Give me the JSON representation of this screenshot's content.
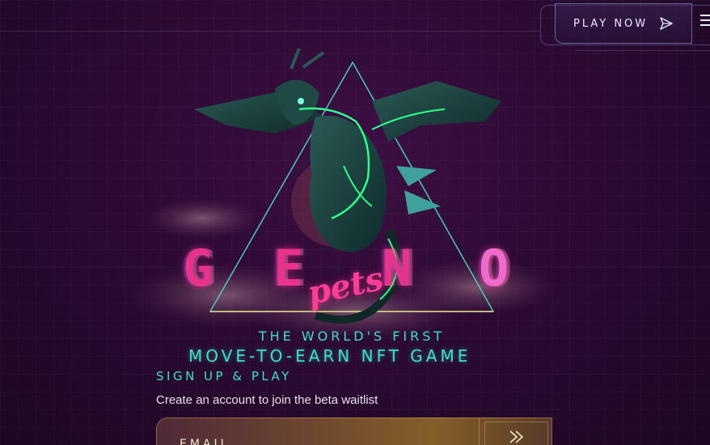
{
  "header": {
    "play_label": "PLAY NOW",
    "play_icon": "paper-plane-icon",
    "menu_icon": "menu-icon"
  },
  "hero": {
    "art_icon": "dragon-illustration",
    "logo": {
      "letters": [
        "G",
        "E",
        "N",
        "O"
      ],
      "sub": "pets"
    }
  },
  "tagline": {
    "line1": "THE WORLD'S FIRST",
    "line2": "MOVE-TO-EARN NFT GAME"
  },
  "signup": {
    "title": "SIGN UP & PLAY",
    "subtitle": "Create an account to join the beta waitlist",
    "email_placeholder": "EMAIL",
    "submit_icon": "double-chevron-right-icon"
  },
  "colors": {
    "background": "#2c0a33",
    "accent_teal": "#39e3c2",
    "accent_pink": "#e8338b",
    "neon_green": "#2dff88"
  }
}
